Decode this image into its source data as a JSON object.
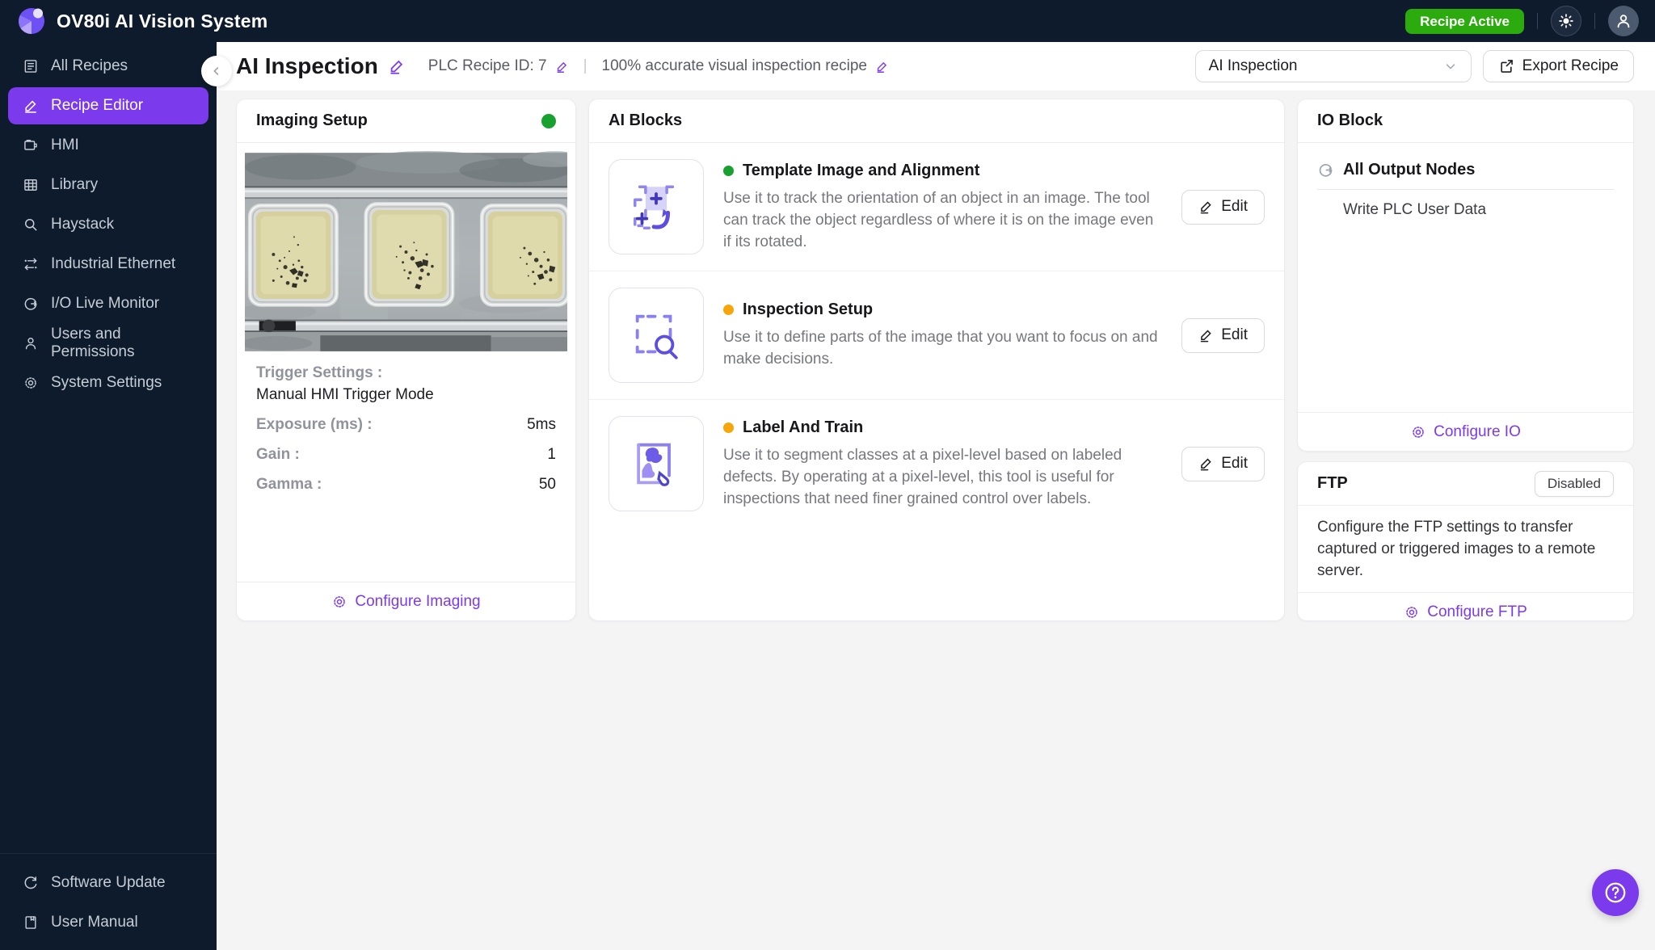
{
  "topbar": {
    "title": "OV80i AI Vision System",
    "recipe_active_label": "Recipe Active"
  },
  "sidebar": {
    "items": [
      {
        "label": "All Recipes",
        "icon": "recipes-list-icon",
        "active": false
      },
      {
        "label": "Recipe Editor",
        "icon": "pencil-icon",
        "active": true
      },
      {
        "label": "HMI",
        "icon": "hmi-monitor-icon",
        "active": false
      },
      {
        "label": "Library",
        "icon": "grid-icon",
        "active": false
      },
      {
        "label": "Haystack",
        "icon": "search-icon",
        "active": false
      },
      {
        "label": "Industrial Ethernet",
        "icon": "ethernet-flow-icon",
        "active": false
      },
      {
        "label": "I/O Live Monitor",
        "icon": "io-monitor-icon",
        "active": false
      },
      {
        "label": "Users and Permissions",
        "icon": "user-icon",
        "active": false
      },
      {
        "label": "System Settings",
        "icon": "gear-icon",
        "active": false
      }
    ],
    "bottom_items": [
      {
        "label": "Software Update",
        "icon": "refresh-icon"
      },
      {
        "label": "User Manual",
        "icon": "manual-book-icon"
      }
    ]
  },
  "header": {
    "title": "AI Inspection",
    "plc_recipe_id": "PLC Recipe ID: 7",
    "separator": "|",
    "description": "100% accurate visual inspection recipe",
    "recipe_select_value": "AI Inspection",
    "export_label": "Export Recipe"
  },
  "imaging": {
    "title": "Imaging Setup",
    "status": "active",
    "trigger_label": "Trigger Settings :",
    "trigger_value": "Manual HMI Trigger Mode",
    "rows": [
      {
        "label": "Exposure (ms) :",
        "value": "5ms"
      },
      {
        "label": "Gain :",
        "value": "1"
      },
      {
        "label": "Gamma :",
        "value": "50"
      }
    ],
    "footer_link": "Configure Imaging"
  },
  "ai_blocks": {
    "title": "AI Blocks",
    "blocks": [
      {
        "status": "active",
        "title": "Template Image and Alignment",
        "description": "Use it to track the orientation of an object in an image. The tool can track the object regardless of where it is on the image even if its rotated.",
        "edit_label": "Edit"
      },
      {
        "status": "warning",
        "title": "Inspection Setup",
        "description": "Use it to define parts of the image that you want to focus on and make decisions.",
        "edit_label": "Edit"
      },
      {
        "status": "warning",
        "title": "Label And Train",
        "description": "Use it to segment classes at a pixel-level based on labeled defects. By operating at a pixel-level, this tool is useful for inspections that need finer grained control over labels.",
        "edit_label": "Edit"
      }
    ]
  },
  "io_block": {
    "title": "IO Block",
    "section_title": "All Output Nodes",
    "node": "Write PLC User Data",
    "footer_link": "Configure IO"
  },
  "ftp": {
    "title": "FTP",
    "badge": "Disabled",
    "description": "Configure the FTP settings to transfer captured or triggered images to a remote server.",
    "footer_link": "Configure FTP"
  },
  "colors": {
    "topbar_bg": "#0d1b2c",
    "accent_purple": "#7c3aed",
    "badge_green": "#2cab0e",
    "status_green": "#18a12e",
    "status_orange": "#f6a60a",
    "page_bg": "#f4f4f5"
  }
}
